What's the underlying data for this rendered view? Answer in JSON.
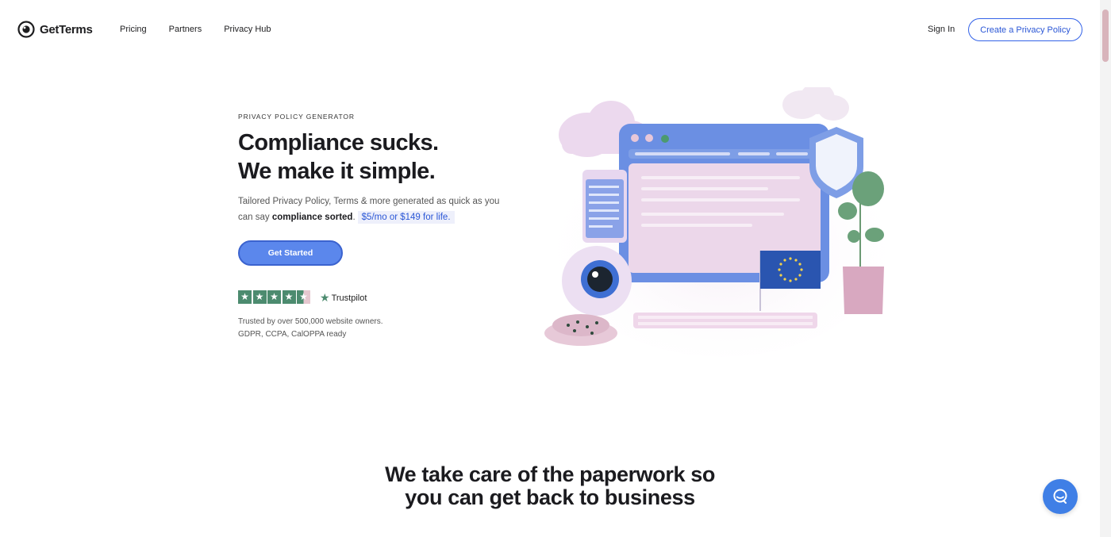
{
  "nav": {
    "logo_text": "GetTerms",
    "links": [
      "Pricing",
      "Partners",
      "Privacy Hub"
    ],
    "sign_in": "Sign In",
    "cta": "Create a Privacy Policy"
  },
  "hero": {
    "eyebrow": "PRIVACY POLICY GENERATOR",
    "headline_line1": "Compliance sucks.",
    "headline_line2": "We make it simple.",
    "desc_part1": "Tailored Privacy Policy, Terms & more generated as quick as you can say ",
    "desc_bold": "compliance sorted",
    "desc_part2": ".",
    "price": "$5/mo or $149 for life.",
    "button": "Get Started",
    "rating_stars": 4.5,
    "trustpilot": "Trustpilot",
    "trusted_line1": "Trusted by over 500,000 website owners.",
    "trusted_line2": "GDPR, CCPA, CalOPPA ready"
  },
  "section": {
    "title_line1": "We take care of the paperwork so",
    "title_line2": "you can get back to business"
  },
  "icons": {
    "logo": "eye-logo-icon",
    "star": "star-icon",
    "chat": "chat-bubble-icon"
  },
  "colors": {
    "accent": "#3463e8",
    "button": "#5b87ec",
    "trustpilot_green": "#4c8b6f",
    "illustration_pink": "#e8c7d8",
    "illustration_blue": "#6b8fe3"
  }
}
